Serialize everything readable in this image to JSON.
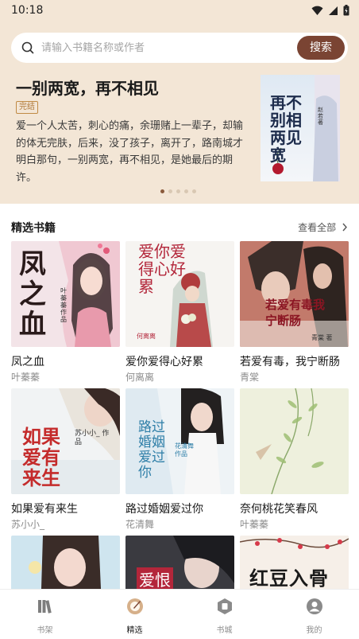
{
  "status_bar": {
    "time": "10:18"
  },
  "search": {
    "placeholder": "请输入书籍名称或作者",
    "button_label": "搜索"
  },
  "banner": {
    "title": "一别两宽，再不相见",
    "badge": "完结",
    "description": "爱一个人太苦，刺心的痛，余珊赌上一辈子，却输的体无完肤，后来，没了孩子，离开了，路南城才明白那句，一别两宽，再不相见，是她最后的期许。",
    "cover_text": "再不别相两见宽",
    "cover_author": "赵若 著",
    "dot_count": 5,
    "active_dot": 1
  },
  "section": {
    "title": "精选书籍",
    "see_all": "查看全部"
  },
  "books": [
    {
      "title": "凤之血",
      "author": "叶蓁蓁",
      "cover_text": "凤之血",
      "cover_author": "叶蓁蓁 作品"
    },
    {
      "title": "爱你爱得心好累",
      "author": "何离离",
      "cover_text": "爱你爱得心好累",
      "cover_author": "何离离"
    },
    {
      "title": "若爱有毒，我宁断肠",
      "author": "青棠",
      "cover_text": "若爱有毒我宁断肠",
      "cover_author": "青棠 著"
    },
    {
      "title": "如果爱有来生",
      "author": "苏小小_",
      "cover_text": "如果爱有来生",
      "cover_author": "苏小小_ 作品"
    },
    {
      "title": "路过婚姻爱过你",
      "author": "花清舞",
      "cover_text": "路过婚姻爱过你",
      "cover_author": "花清舞 作品"
    },
    {
      "title": "奈何桃花笑春风",
      "author": "叶蓁蓁",
      "cover_text": "",
      "cover_author": ""
    },
    {
      "title": "",
      "author": "",
      "cover_text": "",
      "cover_author": ""
    },
    {
      "title": "",
      "author": "",
      "cover_text": "爱恨",
      "cover_author": ""
    },
    {
      "title": "",
      "author": "",
      "cover_text": "红豆入骨",
      "cover_author": ""
    }
  ],
  "nav": [
    {
      "label": "书架",
      "icon": "bookshelf-icon"
    },
    {
      "label": "精选",
      "icon": "featured-icon"
    },
    {
      "label": "书城",
      "icon": "bookstore-icon"
    },
    {
      "label": "我的",
      "icon": "profile-icon"
    }
  ],
  "colors": {
    "accent": "#7a4433",
    "banner_bg": "#f3e6d6",
    "badge": "#c08a44"
  }
}
